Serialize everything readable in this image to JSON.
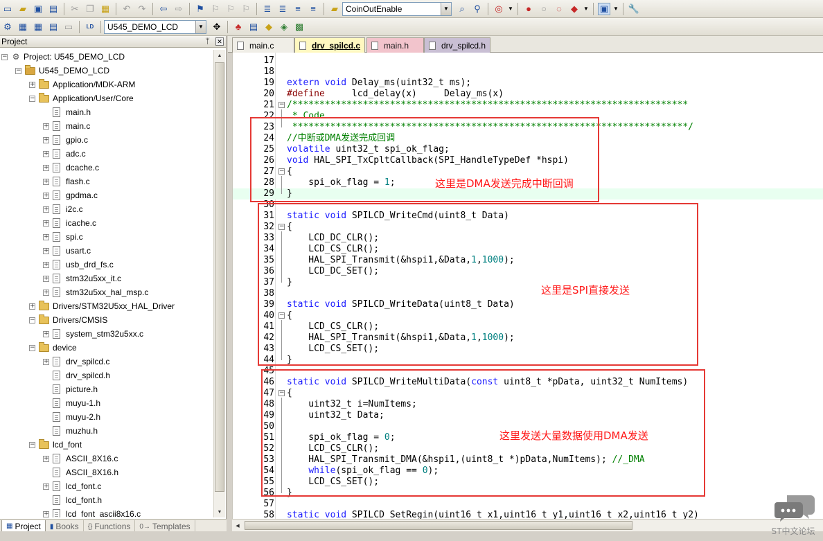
{
  "toolbar": {
    "target_combo": "CoinOutEnable",
    "target_select": "U545_DEMO_LCD"
  },
  "project": {
    "panel_title": "Project",
    "root": "Project: U545_DEMO_LCD",
    "target": "U545_DEMO_LCD",
    "items": [
      {
        "label": "Application/MDK-ARM",
        "kind": "folder",
        "level": 2,
        "exp": "+"
      },
      {
        "label": "Application/User/Core",
        "kind": "folder",
        "level": 2,
        "exp": "-"
      },
      {
        "label": "main.h",
        "kind": "file",
        "level": 3,
        "exp": ""
      },
      {
        "label": "main.c",
        "kind": "file",
        "level": 3,
        "exp": "+"
      },
      {
        "label": "gpio.c",
        "kind": "file",
        "level": 3,
        "exp": "+"
      },
      {
        "label": "adc.c",
        "kind": "file",
        "level": 3,
        "exp": "+"
      },
      {
        "label": "dcache.c",
        "kind": "file",
        "level": 3,
        "exp": "+"
      },
      {
        "label": "flash.c",
        "kind": "file",
        "level": 3,
        "exp": "+"
      },
      {
        "label": "gpdma.c",
        "kind": "file",
        "level": 3,
        "exp": "+"
      },
      {
        "label": "i2c.c",
        "kind": "file",
        "level": 3,
        "exp": "+"
      },
      {
        "label": "icache.c",
        "kind": "file",
        "level": 3,
        "exp": "+"
      },
      {
        "label": "spi.c",
        "kind": "file",
        "level": 3,
        "exp": "+"
      },
      {
        "label": "usart.c",
        "kind": "file",
        "level": 3,
        "exp": "+"
      },
      {
        "label": "usb_drd_fs.c",
        "kind": "file",
        "level": 3,
        "exp": "+"
      },
      {
        "label": "stm32u5xx_it.c",
        "kind": "file",
        "level": 3,
        "exp": "+"
      },
      {
        "label": "stm32u5xx_hal_msp.c",
        "kind": "file",
        "level": 3,
        "exp": "+"
      },
      {
        "label": "Drivers/STM32U5xx_HAL_Driver",
        "kind": "folder",
        "level": 2,
        "exp": "+"
      },
      {
        "label": "Drivers/CMSIS",
        "kind": "folder",
        "level": 2,
        "exp": "-"
      },
      {
        "label": "system_stm32u5xx.c",
        "kind": "file",
        "level": 3,
        "exp": "+"
      },
      {
        "label": "device",
        "kind": "folder",
        "level": 2,
        "exp": "-"
      },
      {
        "label": "drv_spilcd.c",
        "kind": "file",
        "level": 3,
        "exp": "+"
      },
      {
        "label": "drv_spilcd.h",
        "kind": "file",
        "level": 3,
        "exp": ""
      },
      {
        "label": "picture.h",
        "kind": "file",
        "level": 3,
        "exp": ""
      },
      {
        "label": "muyu-1.h",
        "kind": "file",
        "level": 3,
        "exp": ""
      },
      {
        "label": "muyu-2.h",
        "kind": "file",
        "level": 3,
        "exp": ""
      },
      {
        "label": "muzhu.h",
        "kind": "file",
        "level": 3,
        "exp": ""
      },
      {
        "label": "lcd_font",
        "kind": "folder",
        "level": 2,
        "exp": "-"
      },
      {
        "label": "ASCII_8X16.c",
        "kind": "file",
        "level": 3,
        "exp": "+"
      },
      {
        "label": "ASCII_8X16.h",
        "kind": "file",
        "level": 3,
        "exp": ""
      },
      {
        "label": "lcd_font.c",
        "kind": "file",
        "level": 3,
        "exp": "+"
      },
      {
        "label": "lcd_font.h",
        "kind": "file",
        "level": 3,
        "exp": ""
      },
      {
        "label": "lcd_font_ascii8x16.c",
        "kind": "file",
        "level": 3,
        "exp": "+"
      }
    ],
    "bottom_tabs": [
      "Project",
      "Books",
      "Functions",
      "Templates"
    ]
  },
  "editor": {
    "tabs": [
      "main.c",
      "drv_spilcd.c",
      "main.h",
      "drv_spilcd.h"
    ],
    "active_tab": "drv_spilcd.c",
    "lines": [
      {
        "n": "17",
        "t": ""
      },
      {
        "n": "18",
        "t": ""
      },
      {
        "n": "19",
        "t": "extern void Delay_ms(uint32_t ms);"
      },
      {
        "n": "20",
        "t": "#define     lcd_delay(x)     Delay_ms(x)"
      },
      {
        "n": "21",
        "t": "/*************************************************************************"
      },
      {
        "n": "22",
        "t": " * Code"
      },
      {
        "n": "23",
        "t": " *************************************************************************/"
      },
      {
        "n": "24",
        "t": "//中断或DMA发送完成回调"
      },
      {
        "n": "25",
        "t": "volatile uint32_t spi_ok_flag;"
      },
      {
        "n": "26",
        "t": "void HAL_SPI_TxCpltCallback(SPI_HandleTypeDef *hspi)"
      },
      {
        "n": "27",
        "t": "{"
      },
      {
        "n": "28",
        "t": "    spi_ok_flag = 1;"
      },
      {
        "n": "29",
        "t": "}"
      },
      {
        "n": "30",
        "t": ""
      },
      {
        "n": "31",
        "t": "static void SPILCD_WriteCmd(uint8_t Data)"
      },
      {
        "n": "32",
        "t": "{"
      },
      {
        "n": "33",
        "t": "    LCD_DC_CLR();"
      },
      {
        "n": "34",
        "t": "    LCD_CS_CLR();"
      },
      {
        "n": "35",
        "t": "    HAL_SPI_Transmit(&hspi1,&Data,1,1000);"
      },
      {
        "n": "36",
        "t": "    LCD_DC_SET();"
      },
      {
        "n": "37",
        "t": "}"
      },
      {
        "n": "38",
        "t": ""
      },
      {
        "n": "39",
        "t": "static void SPILCD_WriteData(uint8_t Data)"
      },
      {
        "n": "40",
        "t": "{"
      },
      {
        "n": "41",
        "t": "    LCD_CS_CLR();"
      },
      {
        "n": "42",
        "t": "    HAL_SPI_Transmit(&hspi1,&Data,1,1000);"
      },
      {
        "n": "43",
        "t": "    LCD_CS_SET();"
      },
      {
        "n": "44",
        "t": "}"
      },
      {
        "n": "45",
        "t": ""
      },
      {
        "n": "46",
        "t": "static void SPILCD_WriteMultiData(const uint8_t *pData, uint32_t NumItems)"
      },
      {
        "n": "47",
        "t": "{"
      },
      {
        "n": "48",
        "t": "    uint32_t i=NumItems;"
      },
      {
        "n": "49",
        "t": "    uint32_t Data;"
      },
      {
        "n": "50",
        "t": ""
      },
      {
        "n": "51",
        "t": "    spi_ok_flag = 0;"
      },
      {
        "n": "52",
        "t": "    LCD_CS_CLR();"
      },
      {
        "n": "53",
        "t": "    HAL_SPI_Transmit_DMA(&hspi1,(uint8_t *)pData,NumItems); //_DMA"
      },
      {
        "n": "54",
        "t": "    while(spi_ok_flag == 0);"
      },
      {
        "n": "55",
        "t": "    LCD_CS_SET();"
      },
      {
        "n": "56",
        "t": "}"
      },
      {
        "n": "57",
        "t": ""
      },
      {
        "n": "58",
        "t": "static void SPILCD_SetRegin(uint16_t x1,uint16_t y1,uint16_t x2,uint16_t y2)"
      }
    ],
    "annotations": {
      "dma_callback": "这里是DMA发送完成中断回调",
      "spi_direct": "这里是SPI直接发送",
      "dma_bulk": "这里发送大量数据使用DMA发送"
    }
  },
  "watermark": "ST中文论坛",
  "colors": {
    "annotation": "#e53935",
    "keyword": "#1a1aff",
    "comment": "#008000",
    "number": "#008080"
  }
}
